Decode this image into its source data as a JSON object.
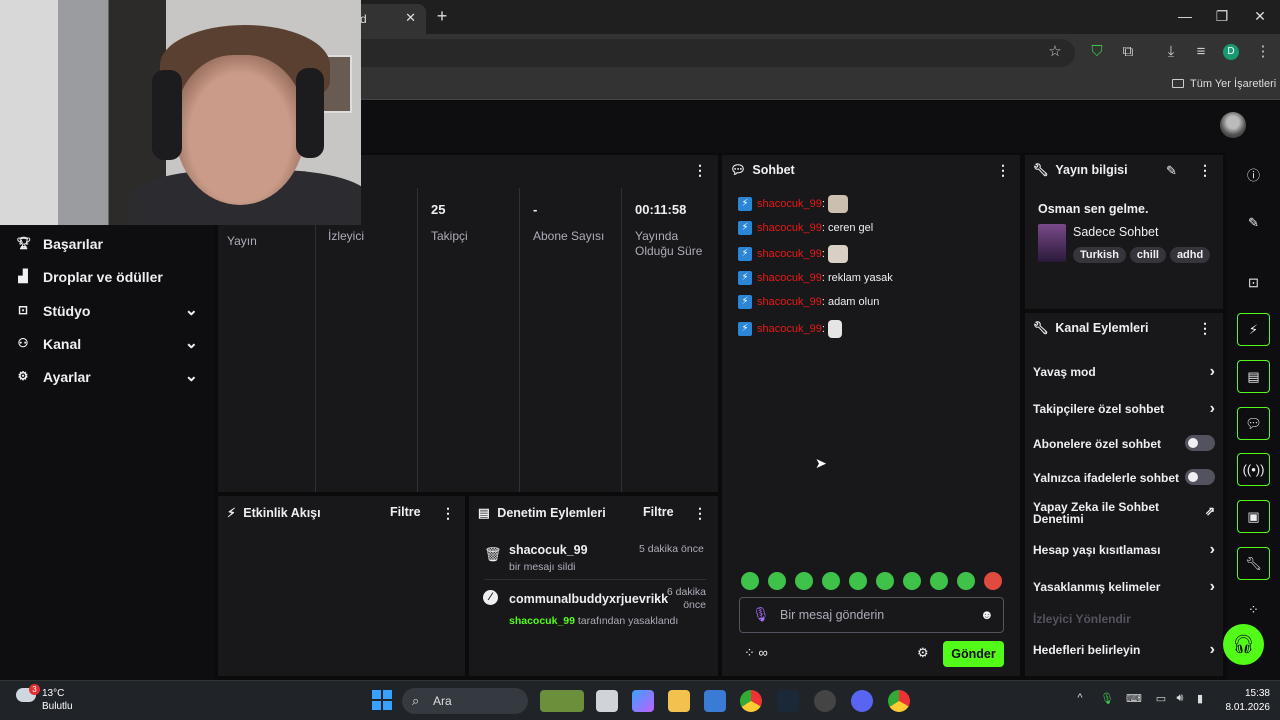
{
  "browser": {
    "tab_title": "d",
    "tab_close": "✕",
    "new_tab": "+",
    "window_controls": {
      "minimize": "—",
      "maximize": "❐",
      "close": "✕"
    },
    "profile_initial": "D",
    "bookmarks_folder": "Tüm Yer İşaretleri"
  },
  "sidebar": {
    "items": [
      {
        "label": "Başarılar",
        "icon": "trophy-icon",
        "expandable": false
      },
      {
        "label": "Droplar ve ödüller",
        "icon": "gift-icon",
        "expandable": false
      },
      {
        "label": "Stüdyo",
        "icon": "studio-icon",
        "expandable": true
      },
      {
        "label": "Kanal",
        "icon": "users-icon",
        "expandable": true
      },
      {
        "label": "Ayarlar",
        "icon": "gear-icon",
        "expandable": true
      }
    ]
  },
  "stats": {
    "columns": [
      {
        "value": "",
        "label": "Yayın"
      },
      {
        "value": "",
        "label": "İzleyici"
      },
      {
        "value": "25",
        "label": "Takipçi"
      },
      {
        "value": "-",
        "label": "Abone Sayısı"
      },
      {
        "value": "00:11:58",
        "label": "Yayında Olduğu Süre"
      }
    ]
  },
  "activity": {
    "title": "Etkinlik Akışı",
    "filter": "Filtre"
  },
  "moderation": {
    "title": "Denetim Eylemleri",
    "filter": "Filtre",
    "items": [
      {
        "user": "shacocuk_99",
        "time": "5 dakika önce",
        "detail": "bir mesajı sildi",
        "actor": ""
      },
      {
        "user": "communalbuddyxrjuevrikk",
        "time": "6 dakika önce",
        "detail": "tarafından yasaklandı",
        "actor": "shacocuk_99"
      }
    ]
  },
  "chat": {
    "title": "Sohbet",
    "messages": [
      {
        "user": "shacocuk_99",
        "text": "",
        "emote": true
      },
      {
        "user": "shacocuk_99",
        "text": "ceren gel",
        "emote": false
      },
      {
        "user": "shacocuk_99",
        "text": "",
        "emote": true
      },
      {
        "user": "shacocuk_99",
        "text": "reklam yasak",
        "emote": false
      },
      {
        "user": "shacocuk_99",
        "text": "adam olun",
        "emote": false
      },
      {
        "user": "shacocuk_99",
        "text": "",
        "emote": true
      }
    ],
    "input_placeholder": "Bir mesaj gönderin",
    "send_label": "Gönder",
    "points_label": "∞",
    "accent": "#53fc18",
    "username_color": "#e91916"
  },
  "stream_info": {
    "title": "Yayın bilgisi",
    "stream_title": "Osman sen gelme.",
    "category": "Sadece Sohbet",
    "tags": [
      "Turkish",
      "chill",
      "adhd"
    ]
  },
  "channel_actions": {
    "title": "Kanal Eylemleri",
    "items": [
      {
        "label": "Yavaş mod",
        "control": "arrow"
      },
      {
        "label": "Takipçilere özel sohbet",
        "control": "arrow"
      },
      {
        "label": "Abonelere özel sohbet",
        "control": "toggle",
        "on": false
      },
      {
        "label": "Yalnızca ifadelerle sohbet",
        "control": "toggle",
        "on": false
      },
      {
        "label": "Yapay Zeka ile Sohbet Denetimi",
        "control": "external"
      },
      {
        "label": "Hesap yaşı kısıtlaması",
        "control": "arrow"
      },
      {
        "label": "Yasaklanmış kelimeler",
        "control": "arrow"
      },
      {
        "label": "İzleyici Yönlendir",
        "control": "none",
        "disabled": true
      },
      {
        "label": "Hedefleri belirleyin",
        "control": "arrow"
      }
    ]
  },
  "taskbar": {
    "weather_temp": "13°C",
    "weather_text": "Bulutlu",
    "weather_badge": "3",
    "search_label": "Ara",
    "time": "15:38",
    "date": "8.01.2026"
  }
}
